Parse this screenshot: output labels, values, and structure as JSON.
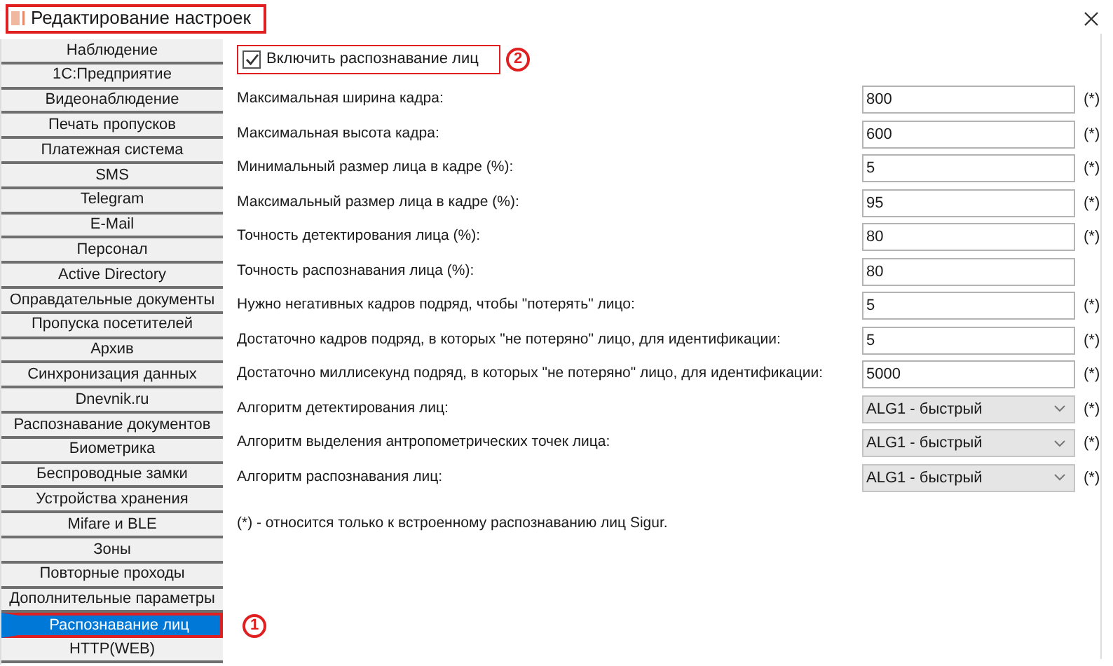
{
  "window": {
    "title": "Редактирование настроек"
  },
  "sidebar": {
    "items": [
      {
        "label": "Наблюдение",
        "selected": false
      },
      {
        "label": "1С:Предприятие",
        "selected": false
      },
      {
        "label": "Видеонаблюдение",
        "selected": false
      },
      {
        "label": "Печать пропусков",
        "selected": false
      },
      {
        "label": "Платежная система",
        "selected": false
      },
      {
        "label": "SMS",
        "selected": false
      },
      {
        "label": "Telegram",
        "selected": false
      },
      {
        "label": "E-Mail",
        "selected": false
      },
      {
        "label": "Персонал",
        "selected": false
      },
      {
        "label": "Active Directory",
        "selected": false
      },
      {
        "label": "Оправдательные документы",
        "selected": false
      },
      {
        "label": "Пропуска посетителей",
        "selected": false
      },
      {
        "label": "Архив",
        "selected": false
      },
      {
        "label": "Синхронизация данных",
        "selected": false
      },
      {
        "label": "Dnevnik.ru",
        "selected": false
      },
      {
        "label": "Распознавание документов",
        "selected": false
      },
      {
        "label": "Биометрика",
        "selected": false
      },
      {
        "label": "Беспроводные замки",
        "selected": false
      },
      {
        "label": "Устройства хранения",
        "selected": false
      },
      {
        "label": "Mifare и BLE",
        "selected": false
      },
      {
        "label": "Зоны",
        "selected": false
      },
      {
        "label": "Повторные проходы",
        "selected": false
      },
      {
        "label": "Дополнительные параметры",
        "selected": false
      },
      {
        "label": "Распознавание лиц",
        "selected": true
      },
      {
        "label": "HTTP(WEB)",
        "selected": false
      }
    ]
  },
  "enable_checkbox": {
    "label": "Включить распознавание лиц",
    "checked": true
  },
  "fields": [
    {
      "label": "Максимальная ширина кадра:",
      "kind": "text",
      "value": "800",
      "note": "(*)"
    },
    {
      "label": "Максимальная высота кадра:",
      "kind": "text",
      "value": "600",
      "note": "(*)"
    },
    {
      "label": "Минимальный размер лица в кадре (%):",
      "kind": "text",
      "value": "5",
      "note": "(*)"
    },
    {
      "label": "Максимальный размер лица в кадре (%):",
      "kind": "text",
      "value": "95",
      "note": "(*)"
    },
    {
      "label": "Точность детектирования лица (%):",
      "kind": "text",
      "value": "80",
      "note": "(*)"
    },
    {
      "label": "Точность распознавания лица (%):",
      "kind": "text",
      "value": "80"
    },
    {
      "label": "Нужно негативных кадров подряд, чтобы \"потерять\" лицо:",
      "kind": "text",
      "value": "5",
      "note": "(*)"
    },
    {
      "label": "Достаточно кадров подряд, в которых \"не потеряно\" лицо, для идентификации:",
      "kind": "text",
      "value": "5",
      "note": "(*)"
    },
    {
      "label": "Достаточно миллисекунд подряд, в которых \"не потеряно\" лицо, для идентификации:",
      "kind": "text",
      "value": "5000",
      "note": "(*)"
    },
    {
      "label": "Алгоритм детектирования лиц:",
      "kind": "dropdown",
      "value": "ALG1 - быстрый",
      "note": "(*)"
    },
    {
      "label": "Алгоритм выделения антропометрических точек лица:",
      "kind": "dropdown",
      "value": "ALG1 - быстрый",
      "note": "(*)"
    },
    {
      "label": "Алгоритм распознавания лиц:",
      "kind": "dropdown",
      "value": "ALG1 - быстрый",
      "note": "(*)"
    }
  ],
  "footnote": "(*) - относится только к встроенному распознаванию лиц Sigur.",
  "callouts": [
    "1",
    "2"
  ]
}
